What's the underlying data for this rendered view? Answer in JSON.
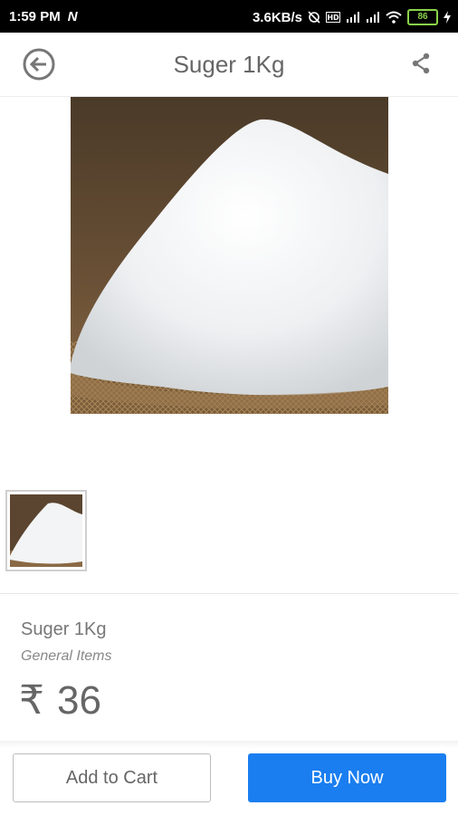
{
  "status_bar": {
    "time": "1:59 PM",
    "net_icon": "N",
    "speed": "3.6KB/s",
    "battery": "86"
  },
  "app_bar": {
    "title": "Suger 1Kg",
    "back_icon": "back-arrow-circle",
    "share_icon": "share"
  },
  "product": {
    "name": "Suger 1Kg",
    "category": "General Items",
    "currency_symbol": "₹",
    "price": "36"
  },
  "actions": {
    "add_to_cart": "Add to Cart",
    "buy_now": "Buy Now"
  },
  "colors": {
    "primary": "#1a7ef0",
    "battery": "#8bd34a"
  }
}
